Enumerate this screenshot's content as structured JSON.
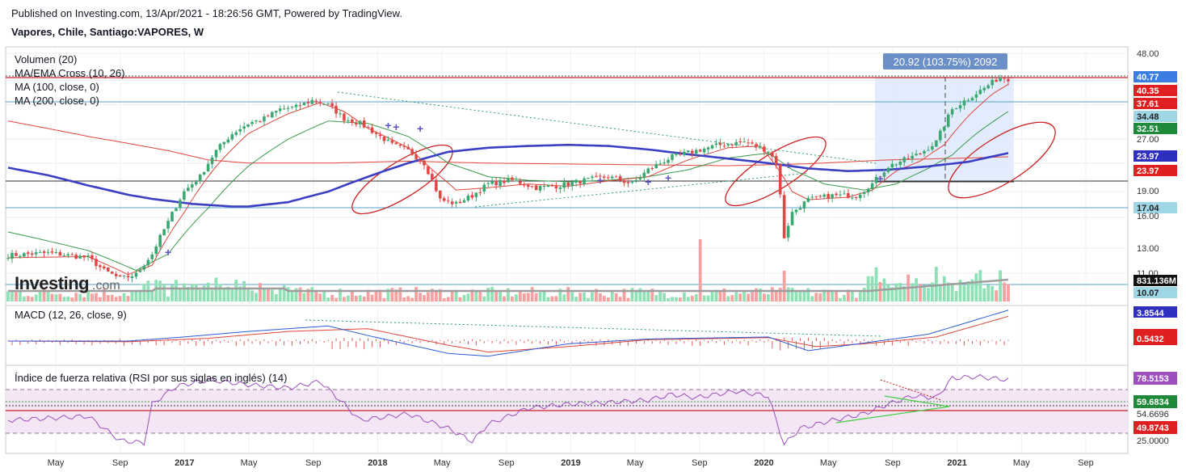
{
  "header": {
    "published": "Published on Investing.com, 13/Apr/2021 - 18:26:56 GMT, Powered by TradingView.",
    "symbol": "Vapores, Chile, Santiago:VAPORES, W"
  },
  "logo": {
    "main": "Investing",
    "suffix": ".com"
  },
  "chart_data": {
    "type": "candlestick",
    "grid": true,
    "legend": "top-left",
    "colors": {
      "up": "#3aa870",
      "down": "#e04848",
      "ma100": "#3b3fc4",
      "ma200": "#e0463c",
      "ema_fast": "#e0463c",
      "ema_slow": "#3a9a4a",
      "rsi": "#9c4fbd",
      "macd": "#2d5bd6",
      "signal": "#e0463c",
      "volume_ma": "#9e9e9e",
      "box": "#dde9fb",
      "box_label": "#6b8fc7"
    },
    "price_panel": {
      "legend": [
        "Volumen (20)",
        "MA/EMA Cross (10, 26)",
        "MA (100, close, 0)",
        "MA (200, close, 0)"
      ],
      "y_axis": [
        "48.00",
        "40.77",
        "40.35",
        "37.61",
        "34.48",
        "32.51",
        "27.00",
        "23.97",
        "23.97",
        "19.00",
        "17.04",
        "16.00",
        "13.00",
        "11.00",
        "831.136M",
        "10.07"
      ],
      "ylim": [
        10.0,
        49.0
      ],
      "scale": "log",
      "measure_label": "20.92 (103.75%) 2092",
      "series_waypoints": {
        "close": [
          [
            0,
            12.4
          ],
          [
            10,
            12.6
          ],
          [
            20,
            12.2
          ],
          [
            24,
            11.2
          ],
          [
            28,
            10.6
          ],
          [
            32,
            10.9
          ],
          [
            36,
            12.5
          ],
          [
            40,
            15.5
          ],
          [
            44,
            19.0
          ],
          [
            48,
            21.0
          ],
          [
            52,
            25.0
          ],
          [
            56,
            28.0
          ],
          [
            60,
            30.0
          ],
          [
            64,
            31.0
          ],
          [
            68,
            33.0
          ],
          [
            72,
            33.5
          ],
          [
            76,
            35.0
          ],
          [
            80,
            34.0
          ],
          [
            84,
            31.0
          ],
          [
            88,
            30.0
          ],
          [
            92,
            28.0
          ],
          [
            96,
            26.0
          ],
          [
            100,
            25.0
          ],
          [
            104,
            23.0
          ],
          [
            108,
            18.0
          ],
          [
            112,
            17.5
          ],
          [
            116,
            18.5
          ],
          [
            120,
            20.0
          ],
          [
            126,
            20.5
          ],
          [
            132,
            19.5
          ],
          [
            138,
            19.8
          ],
          [
            144,
            20.5
          ],
          [
            150,
            21.0
          ],
          [
            156,
            20.0
          ],
          [
            160,
            22.0
          ],
          [
            166,
            24.0
          ],
          [
            172,
            25.0
          ],
          [
            178,
            26.0
          ],
          [
            184,
            26.5
          ],
          [
            190,
            25.0
          ],
          [
            192,
            23.0
          ],
          [
            194,
            14.0
          ],
          [
            196,
            16.5
          ],
          [
            200,
            18.0
          ],
          [
            206,
            18.5
          ],
          [
            212,
            18.5
          ],
          [
            216,
            20.0
          ],
          [
            220,
            22.5
          ],
          [
            224,
            23.5
          ],
          [
            228,
            24.5
          ],
          [
            232,
            26.5
          ],
          [
            236,
            33.0
          ],
          [
            240,
            35.5
          ],
          [
            244,
            38.0
          ],
          [
            248,
            41.0
          ],
          [
            250,
            40.5
          ]
        ],
        "ma100": [
          [
            0,
            22.3
          ],
          [
            10,
            21.2
          ],
          [
            20,
            19.8
          ],
          [
            30,
            18.6
          ],
          [
            36,
            18.1
          ],
          [
            46,
            17.5
          ],
          [
            56,
            17.2
          ],
          [
            60,
            17.2
          ],
          [
            70,
            17.7
          ],
          [
            80,
            19.0
          ],
          [
            90,
            21.0
          ],
          [
            100,
            23.0
          ],
          [
            110,
            24.8
          ],
          [
            120,
            25.5
          ],
          [
            130,
            25.8
          ],
          [
            140,
            26.0
          ],
          [
            150,
            25.8
          ],
          [
            160,
            25.2
          ],
          [
            170,
            24.4
          ],
          [
            180,
            23.7
          ],
          [
            190,
            23.0
          ],
          [
            200,
            22.2
          ],
          [
            210,
            21.8
          ],
          [
            220,
            22.0
          ],
          [
            230,
            22.5
          ],
          [
            240,
            23.2
          ],
          [
            250,
            24.6
          ]
        ],
        "ma200": [
          [
            0,
            30.5
          ],
          [
            20,
            27.5
          ],
          [
            40,
            25.0
          ],
          [
            50,
            23.5
          ],
          [
            60,
            23.0
          ],
          [
            80,
            23.0
          ],
          [
            100,
            23.3
          ],
          [
            120,
            23.0
          ],
          [
            150,
            22.8
          ],
          [
            180,
            22.6
          ],
          [
            200,
            22.9
          ],
          [
            220,
            23.5
          ],
          [
            240,
            23.8
          ],
          [
            250,
            24.0
          ]
        ],
        "ema10": [
          [
            0,
            12.2
          ],
          [
            20,
            12.3
          ],
          [
            30,
            10.9
          ],
          [
            36,
            11.6
          ],
          [
            44,
            16.5
          ],
          [
            52,
            22.5
          ],
          [
            60,
            28.0
          ],
          [
            70,
            32.0
          ],
          [
            78,
            34.5
          ],
          [
            84,
            32.5
          ],
          [
            90,
            29.0
          ],
          [
            100,
            25.5
          ],
          [
            106,
            22.0
          ],
          [
            112,
            19.2
          ],
          [
            120,
            19.5
          ],
          [
            130,
            20.0
          ],
          [
            140,
            19.7
          ],
          [
            150,
            20.4
          ],
          [
            160,
            21.0
          ],
          [
            170,
            23.5
          ],
          [
            180,
            25.5
          ],
          [
            188,
            25.8
          ],
          [
            192,
            22.5
          ],
          [
            196,
            19.0
          ],
          [
            200,
            18.0
          ],
          [
            210,
            18.3
          ],
          [
            216,
            19.2
          ],
          [
            222,
            21.8
          ],
          [
            228,
            23.3
          ],
          [
            234,
            26.0
          ],
          [
            240,
            31.5
          ],
          [
            246,
            36.5
          ],
          [
            250,
            39.0
          ]
        ],
        "ema26": [
          [
            0,
            14.5
          ],
          [
            20,
            12.8
          ],
          [
            32,
            11.2
          ],
          [
            40,
            12.5
          ],
          [
            50,
            17.0
          ],
          [
            60,
            22.5
          ],
          [
            70,
            27.0
          ],
          [
            80,
            30.5
          ],
          [
            90,
            30.0
          ],
          [
            100,
            27.5
          ],
          [
            110,
            23.0
          ],
          [
            120,
            21.0
          ],
          [
            130,
            20.5
          ],
          [
            140,
            20.3
          ],
          [
            150,
            20.5
          ],
          [
            160,
            21.0
          ],
          [
            170,
            22.0
          ],
          [
            180,
            23.8
          ],
          [
            190,
            24.6
          ],
          [
            196,
            22.0
          ],
          [
            204,
            20.0
          ],
          [
            214,
            19.2
          ],
          [
            222,
            20.0
          ],
          [
            230,
            22.2
          ],
          [
            236,
            24.3
          ],
          [
            242,
            28.0
          ],
          [
            250,
            32.5
          ]
        ]
      },
      "signals": [
        "cross",
        "cross",
        "cross",
        "cross",
        "cross",
        "cross",
        "cross",
        "cross",
        "cross",
        "cross"
      ]
    },
    "macd": {
      "legend": "MACD (12, 26, close, 9)",
      "y_axis": [
        "3.8544",
        "0.5432"
      ]
    },
    "rsi": {
      "legend": "Índice de fuerza relativa (RSI por sus siglas en inglés) (14)",
      "y_axis": [
        "78.5153",
        "59.6834",
        "54.6696",
        "49.8743",
        "25.0000"
      ]
    },
    "x_axis": [
      "May",
      "Sep",
      "2017",
      "May",
      "Sep",
      "2018",
      "May",
      "Sep",
      "2019",
      "May",
      "Sep",
      "2020",
      "May",
      "Sep",
      "2021",
      "May",
      "Sep"
    ]
  }
}
